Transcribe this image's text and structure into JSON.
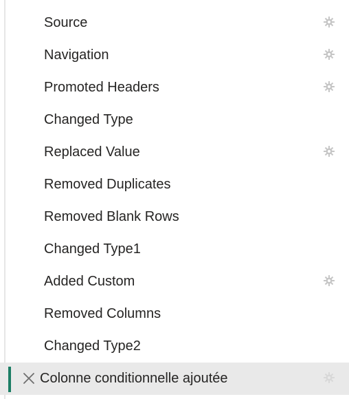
{
  "steps": [
    {
      "label": "Source",
      "has_settings": true
    },
    {
      "label": "Navigation",
      "has_settings": true
    },
    {
      "label": "Promoted Headers",
      "has_settings": true
    },
    {
      "label": "Changed Type",
      "has_settings": false
    },
    {
      "label": "Replaced Value",
      "has_settings": true
    },
    {
      "label": "Removed Duplicates",
      "has_settings": false
    },
    {
      "label": "Removed Blank Rows",
      "has_settings": false
    },
    {
      "label": "Changed Type1",
      "has_settings": false
    },
    {
      "label": "Added Custom",
      "has_settings": true
    },
    {
      "label": "Removed Columns",
      "has_settings": false
    },
    {
      "label": "Changed Type2",
      "has_settings": false
    },
    {
      "label": "Colonne conditionnelle ajoutée",
      "has_settings": true,
      "selected": true
    }
  ],
  "icons": {
    "settings": "gear-icon",
    "delete": "close-icon"
  },
  "colors": {
    "selected_accent": "#1b7d64",
    "selected_background": "#e9e9e9",
    "gear": "#c6c6c6"
  }
}
